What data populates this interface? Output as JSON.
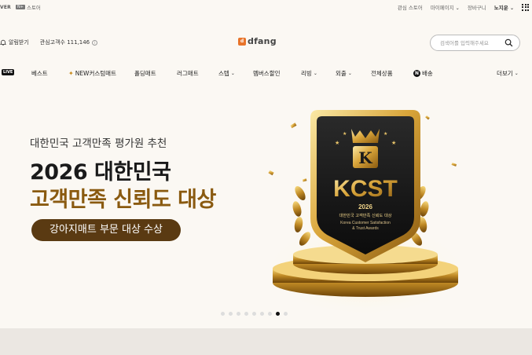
{
  "topbar": {
    "naver": "VER",
    "store_label": "스토어",
    "links": [
      "관심 스토어",
      "마이페이지",
      "장바구니"
    ],
    "user": "노지운"
  },
  "header": {
    "alarm_label": "알림받기",
    "followers_label": "관심고객수 111,146",
    "logo_text": "dfang",
    "search_placeholder": "검색어를 입력해주세요"
  },
  "nav": {
    "live": "LIVE",
    "items": [
      "베스트",
      "NEW커스텀매트",
      "폴딩매트",
      "러그매트",
      "스텝",
      "멤버스할인",
      "리빙",
      "외출",
      "전체상품",
      "배송"
    ],
    "more": "더보기"
  },
  "hero": {
    "subtitle": "대한민국 고객만족 평가원 추천",
    "title_line1": "2026 대한민국",
    "title_line2": "고객만족 신뢰도 대상",
    "pill": "강아지매트 부문 대상 수상",
    "badge": {
      "letter": "K",
      "main": "KCST",
      "year": "2026",
      "line1": "대한민국 고객만족 신뢰도 대상",
      "line2": "Korea Customer Satisfaction",
      "line3": "& Trust Awards"
    },
    "slide_count": 9,
    "active_slide": 8
  },
  "colors": {
    "accent_brown": "#5a3a12",
    "title_gold": "#8a5a10",
    "logo_orange": "#e8742a",
    "background": "#fbf8f3"
  }
}
